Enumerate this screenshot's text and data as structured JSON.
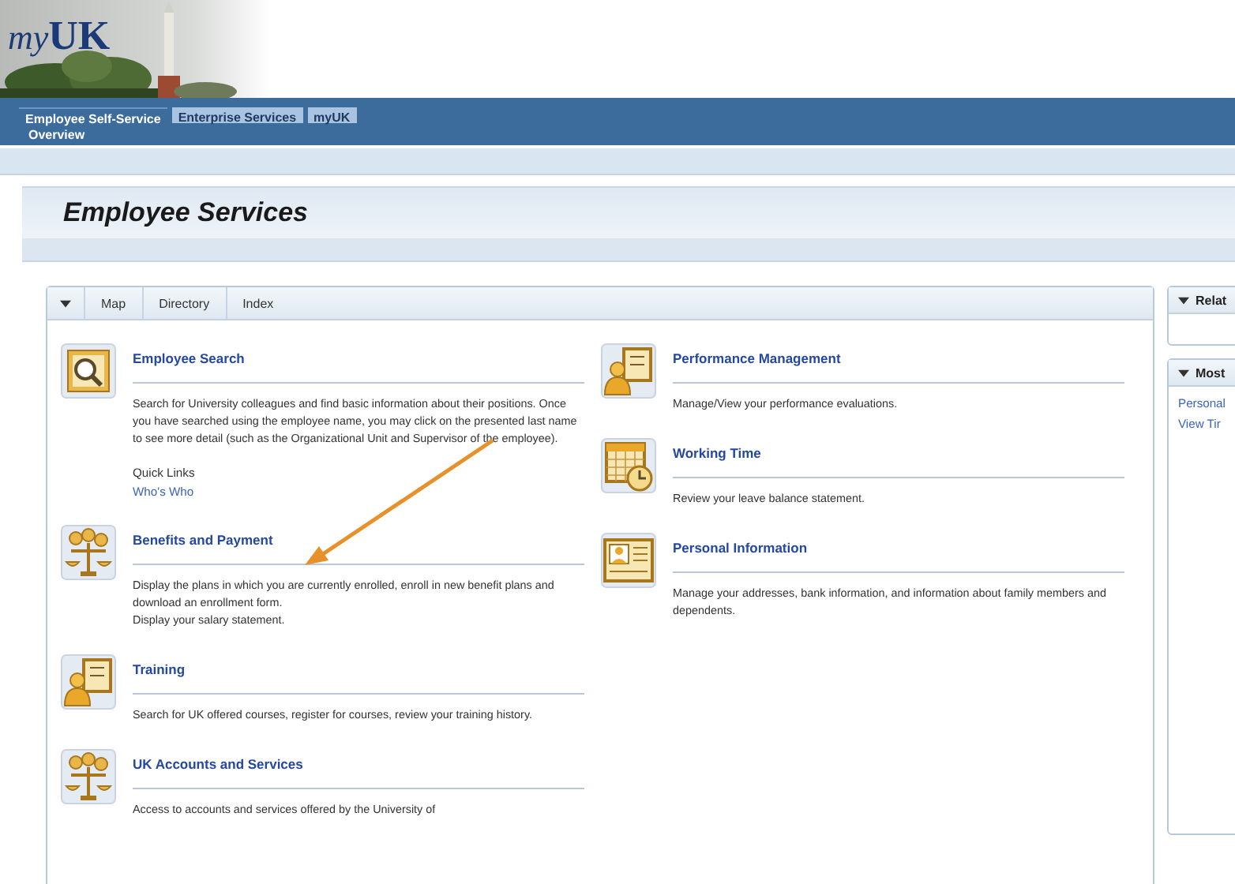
{
  "header": {
    "logo_prefix": "my",
    "logo_main": "UK",
    "tabs": [
      {
        "label": "Employee Self-Service",
        "selected": true
      },
      {
        "label": "Enterprise Services",
        "selected": false
      },
      {
        "label": "myUK",
        "selected": false
      }
    ],
    "subnav": [
      {
        "label": "Overview",
        "selected": true
      }
    ]
  },
  "page_title": "Employee Services",
  "panel": {
    "tabs": [
      {
        "label": "Map"
      },
      {
        "label": "Directory"
      },
      {
        "label": "Index"
      }
    ],
    "columns": [
      [
        {
          "kind": "search",
          "title": "Employee Search",
          "description": [
            "Search for University colleagues and find basic information about their positions. Once you have searched using the employee name, you may click on the presented last name to see more detail (such as the Organizational Unit and Supervisor of the employee)."
          ],
          "quick_links_label": "Quick Links",
          "quick_links": [
            "Who's Who"
          ]
        },
        {
          "kind": "scales",
          "title": "Benefits and Payment",
          "description": [
            "Display the plans in which you are currently enrolled, enroll in new benefit plans and download an enrollment form.",
            "Display your salary statement."
          ]
        },
        {
          "kind": "person-board",
          "title": "Training",
          "description": [
            "Search for UK offered courses, register for courses, review your training history."
          ]
        },
        {
          "kind": "scales",
          "title": "UK Accounts and Services",
          "description": [
            "Access to accounts and services offered by the University of"
          ]
        }
      ],
      [
        {
          "kind": "person-board",
          "title": "Performance Management",
          "description": [
            "Manage/View your performance evaluations."
          ]
        },
        {
          "kind": "calendar-clock",
          "title": "Working Time",
          "description": [
            "Review your leave balance statement."
          ]
        },
        {
          "kind": "id-card",
          "title": "Personal Information",
          "description": [
            "Manage your addresses, bank information, and information about family members and dependents."
          ]
        }
      ]
    ]
  },
  "side_panels": [
    {
      "title": "Relat"
    },
    {
      "title": "Most",
      "links": [
        "Personal",
        "View Tir"
      ]
    }
  ]
}
